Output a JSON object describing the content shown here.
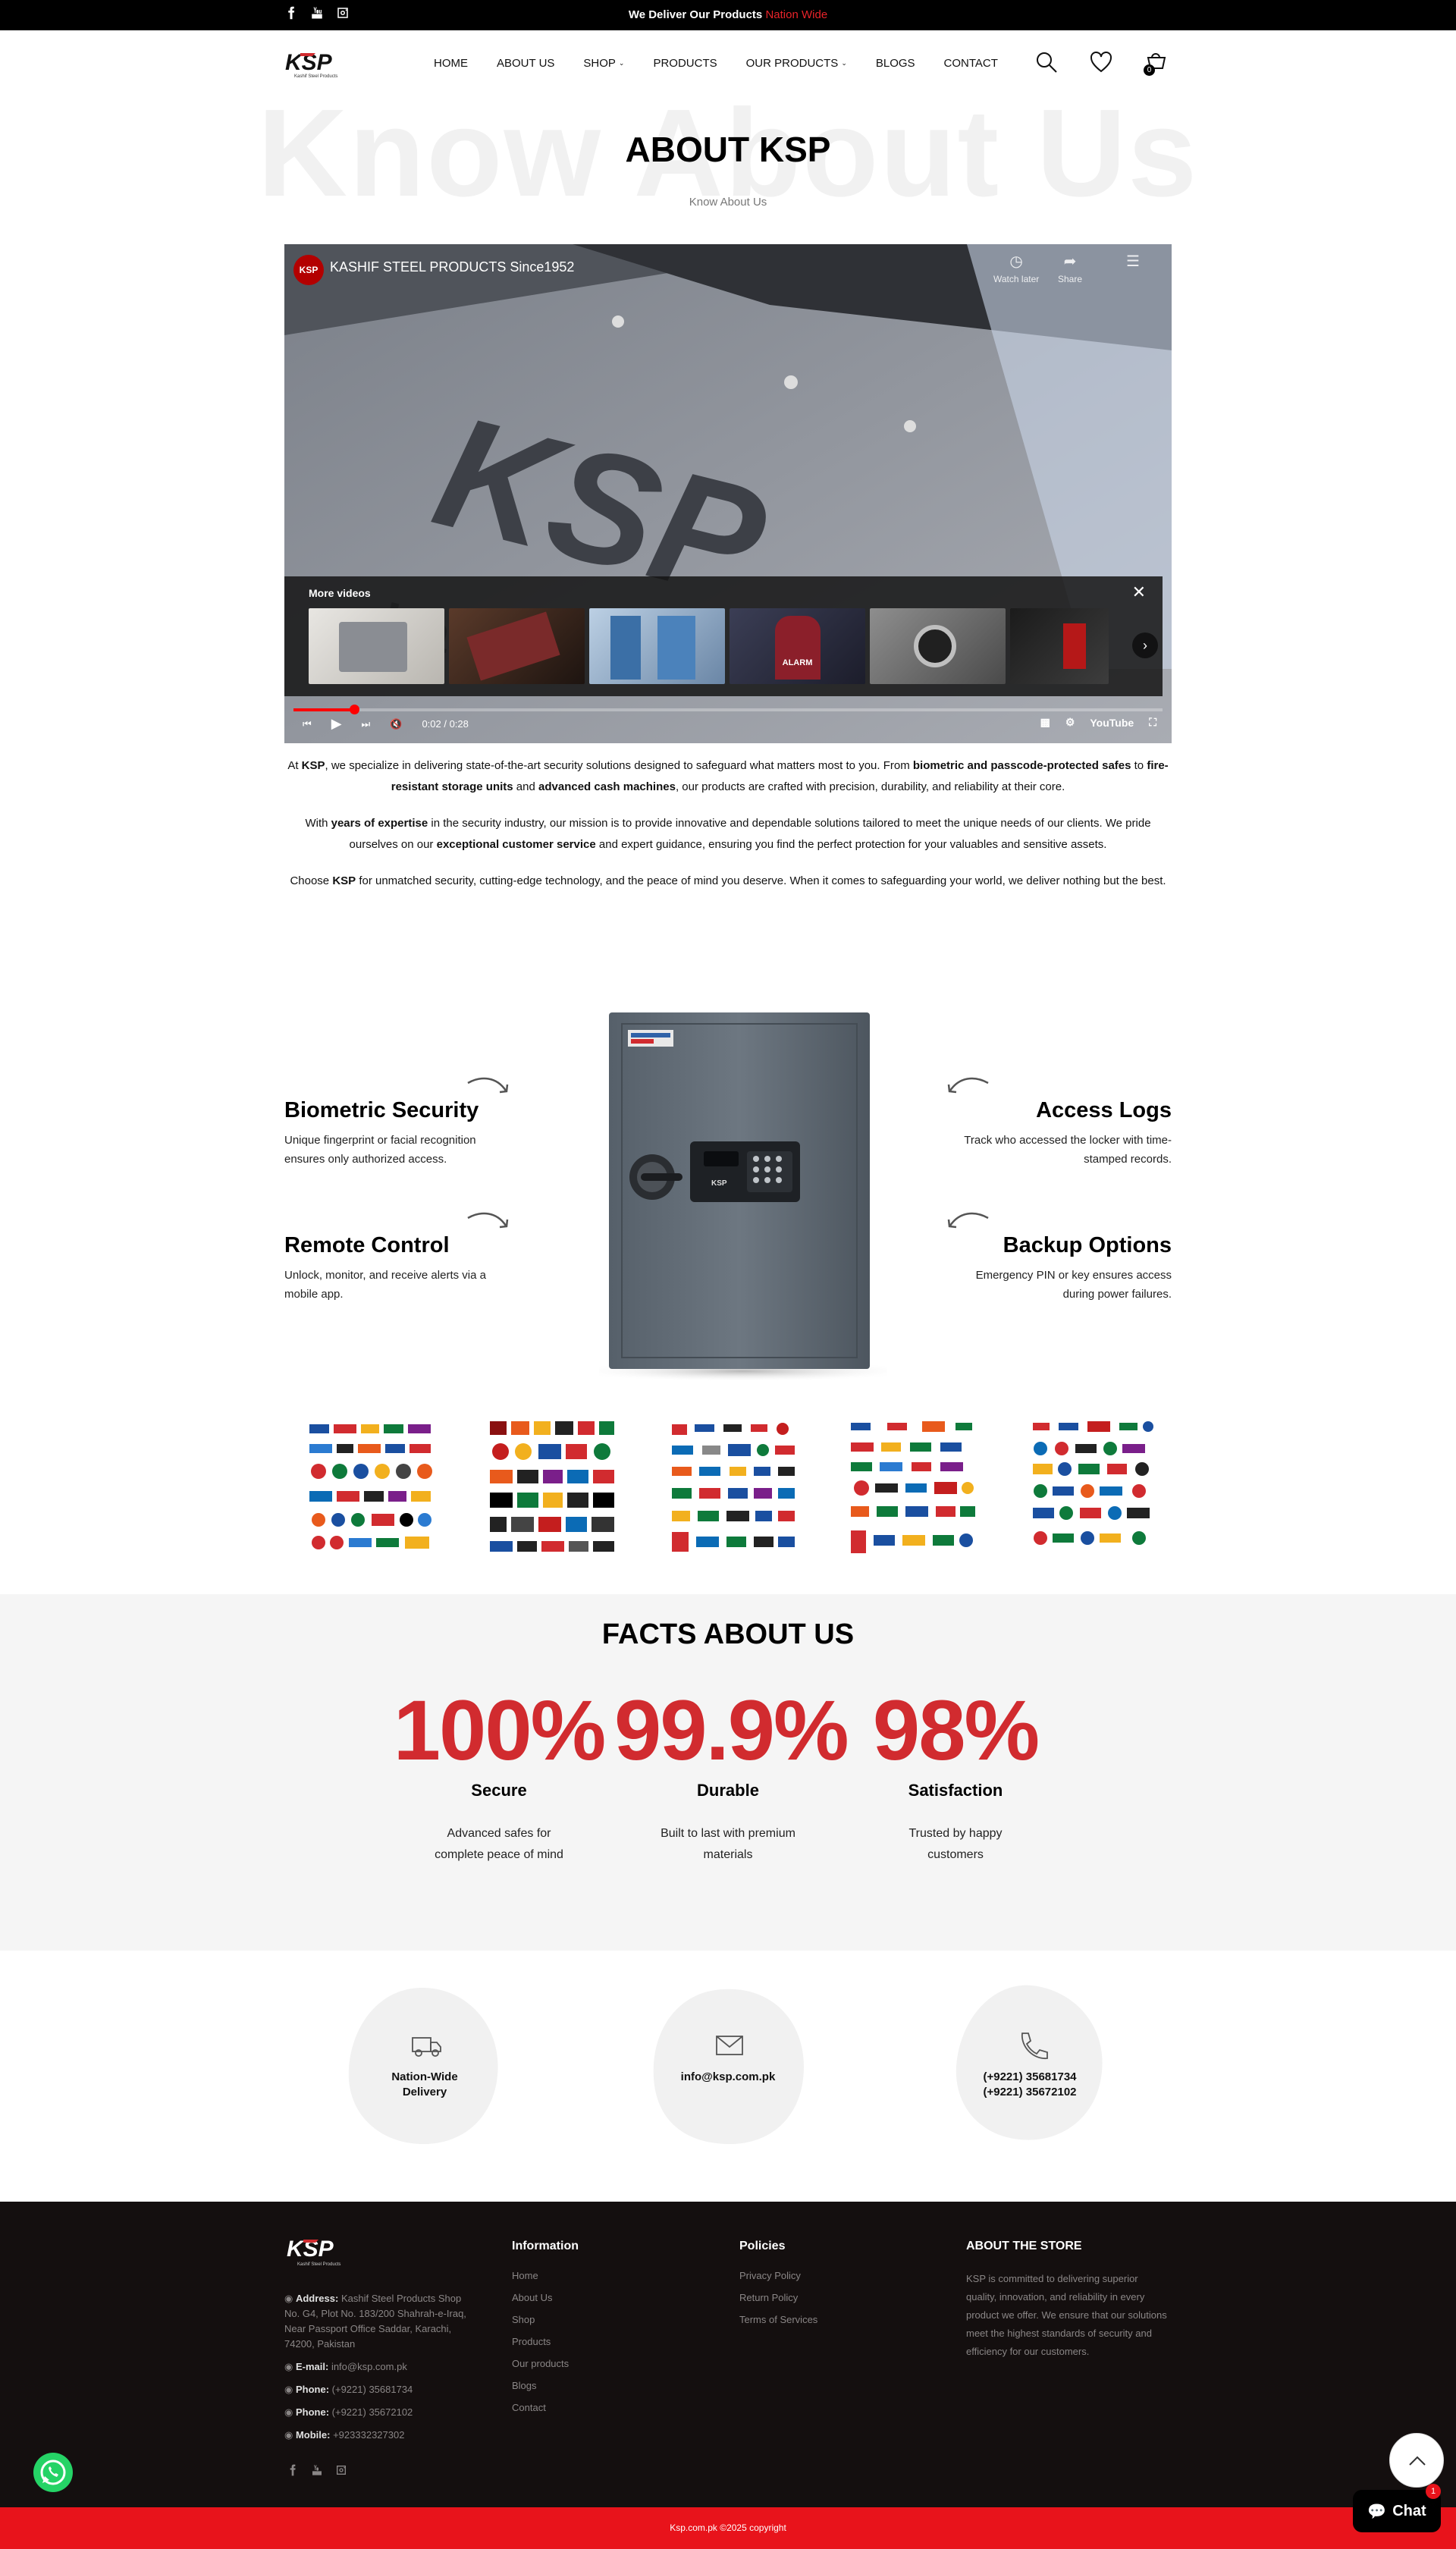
{
  "topbar": {
    "message_prefix": "We Deliver Our Products",
    "message_highlight": "Nation Wide"
  },
  "brand": {
    "logo_text": "KSP",
    "logo_tagline": "Kashif Steel Products"
  },
  "nav": {
    "items": [
      {
        "label": "HOME"
      },
      {
        "label": "ABOUT US"
      },
      {
        "label": "SHOP",
        "dropdown": true
      },
      {
        "label": "PRODUCTS"
      },
      {
        "label": "OUR PRODUCTS",
        "dropdown": true
      },
      {
        "label": "BLOGS"
      },
      {
        "label": "CONTACT"
      }
    ],
    "cart_count": "0"
  },
  "hero": {
    "ghost_text": "Know About Us",
    "title": "ABOUT KSP",
    "breadcrumb": "Know About Us"
  },
  "video": {
    "title": "KASHIF STEEL PRODUCTS Since1952",
    "channel_badge": "KSP",
    "watch_later": "Watch later",
    "share": "Share",
    "more_videos": "More videos",
    "thumb_label": "ALARM",
    "time": "0:02 / 0:28",
    "progress_fraction": 0.07,
    "youtube_label": "YouTube"
  },
  "intro": {
    "p1": [
      {
        "t": "At ",
        "b": false
      },
      {
        "t": "KSP",
        "b": true
      },
      {
        "t": ", we specialize in delivering state-of-the-art security solutions designed to safeguard what matters most to you. From ",
        "b": false
      },
      {
        "t": "biometric and passcode-protected safes",
        "b": true
      },
      {
        "t": " to ",
        "b": false
      },
      {
        "t": "fire-resistant storage units",
        "b": true
      },
      {
        "t": " and ",
        "b": false
      },
      {
        "t": "advanced cash machines",
        "b": true
      },
      {
        "t": ", our products are crafted with precision, durability, and reliability at their core.",
        "b": false
      }
    ],
    "p2": [
      {
        "t": "With ",
        "b": false
      },
      {
        "t": "years of expertise",
        "b": true
      },
      {
        "t": " in the security industry, our mission is to provide innovative and dependable solutions tailored to meet the unique needs of our clients. We pride ourselves on our ",
        "b": false
      },
      {
        "t": "exceptional customer service",
        "b": true
      },
      {
        "t": " and expert guidance, ensuring you find the perfect protection for your valuables and sensitive assets.",
        "b": false
      }
    ],
    "p3": [
      {
        "t": "Choose ",
        "b": false
      },
      {
        "t": "KSP",
        "b": true
      },
      {
        "t": " for unmatched security, cutting-edge technology, and the peace of mind you deserve. When it comes to safeguarding your world, we deliver nothing but the best.",
        "b": false
      }
    ]
  },
  "features": {
    "biometric": {
      "title": "Biometric Security",
      "desc": "Unique fingerprint or facial recognition ensures only authorized access."
    },
    "remote": {
      "title": "Remote Control",
      "desc": "Unlock, monitor, and receive alerts via a mobile app."
    },
    "access": {
      "title": "Access Logs",
      "desc": "Track who accessed the locker with time-stamped records."
    },
    "backup": {
      "title": "Backup Options",
      "desc": "Emergency PIN or key ensures access during power failures."
    }
  },
  "safe": {
    "keypad_brand": "KSP"
  },
  "facts": {
    "title": "FACTS ABOUT US",
    "items": [
      {
        "value": "100%",
        "label": "Secure",
        "desc": "Advanced safes for complete peace of mind"
      },
      {
        "value": "99.9%",
        "label": "Durable",
        "desc": "Built to last with premium materials"
      },
      {
        "value": "98%",
        "label": "Satisfaction",
        "desc": "Trusted by happy customers"
      }
    ]
  },
  "contact": {
    "delivery_line1": "Nation-Wide",
    "delivery_line2": "Delivery",
    "email": "info@ksp.com.pk",
    "phone1": "(+9221) 35681734",
    "phone2": "(+9221) 35672102"
  },
  "footer": {
    "address_label": "Address:",
    "address_text": "Kashif Steel Products Shop No. G4, Plot No. 183/200 Shahrah-e-Iraq, Near Passport Office Saddar, Karachi, 74200, Pakistan",
    "email_label": "E-mail:",
    "email": "info@ksp.com.pk",
    "phone_label": "Phone:",
    "phone1": "(+9221) 35681734",
    "phone2": "(+9221) 35672102",
    "mobile_label": "Mobile:",
    "mobile": "+923332327302",
    "info_title": "Information",
    "info_links": [
      "Home",
      "About Us",
      "Shop",
      "Products",
      "Our products",
      "Blogs",
      "Contact"
    ],
    "policies_title": "Policies",
    "policy_links": [
      "Privacy Policy",
      "Return Policy",
      "Terms of Services"
    ],
    "about_title": "ABOUT THE STORE",
    "about_text": "KSP is committed to delivering superior quality, innovation, and reliability in every product we offer. We ensure that our solutions meet the highest standards of security and efficiency for our customers.",
    "copyright": "Ksp.com.pk ©2025 copyright"
  },
  "widgets": {
    "chat_label": "Chat",
    "chat_badge": "1"
  },
  "colors": {
    "accent_red": "#e8131b",
    "fact_red": "#d12b2f",
    "footer_bg": "#140f0f"
  }
}
